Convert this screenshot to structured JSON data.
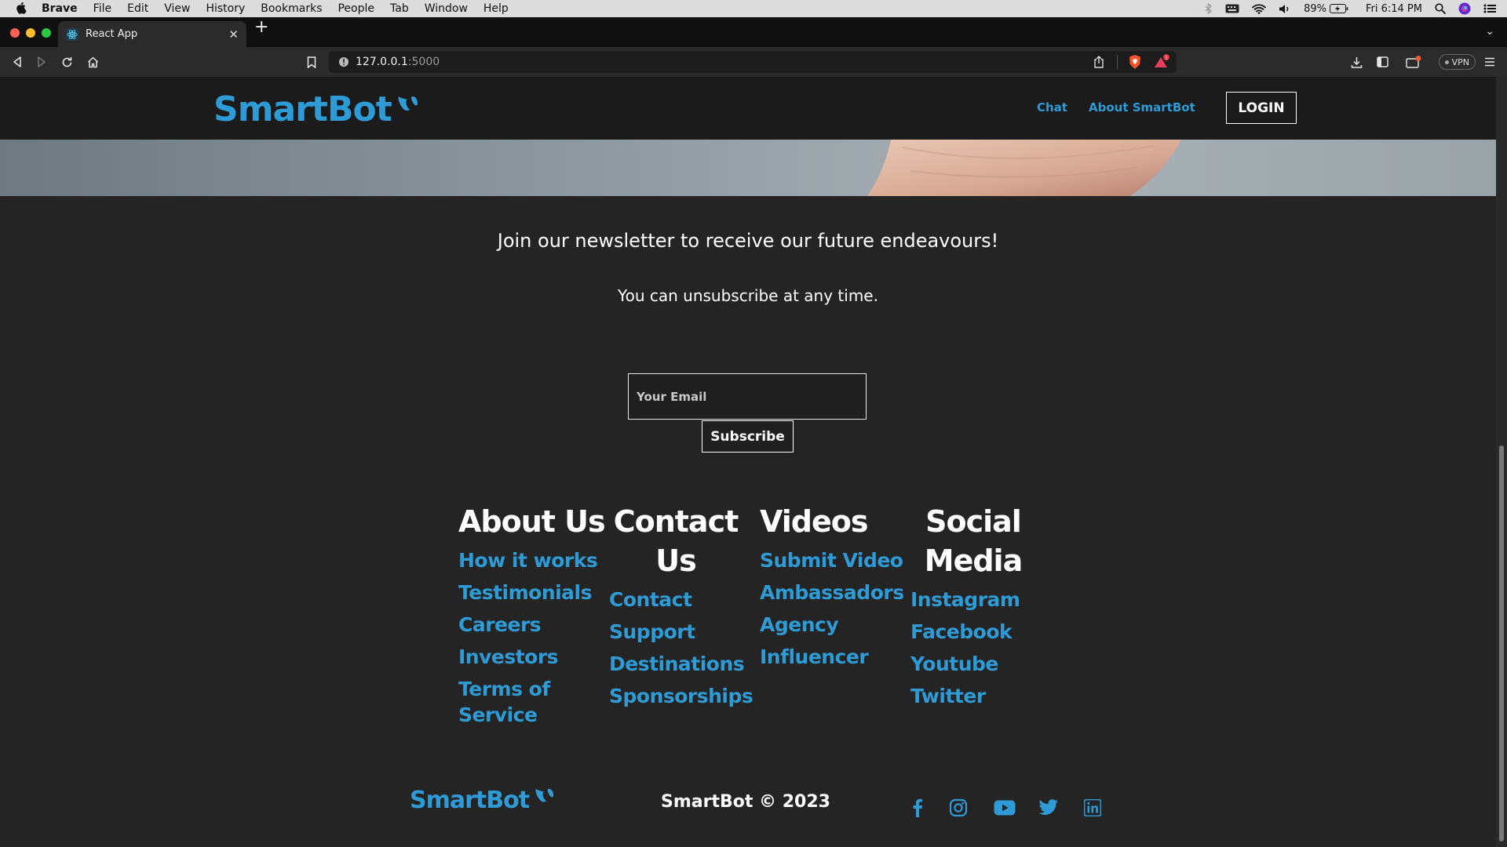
{
  "menubar": {
    "app_name": "Brave",
    "items": [
      "File",
      "Edit",
      "View",
      "History",
      "Bookmarks",
      "People",
      "Tab",
      "Window",
      "Help"
    ],
    "battery": "89%",
    "clock": "Fri 6:14 PM"
  },
  "browser": {
    "tab_title": "React App",
    "url_host": "127.0.0.1",
    "url_port": ":5000",
    "vpn_label": "VPN"
  },
  "nav": {
    "brand": "SmartBot",
    "links": [
      "Chat",
      "About SmartBot"
    ],
    "login_label": "LOGIN"
  },
  "newsletter": {
    "title": "Join our newsletter to receive our future endeavours!",
    "subtitle": "You can unsubscribe at any time.",
    "email_placeholder": "Your Email",
    "subscribe_label": "Subscribe"
  },
  "footer": {
    "columns": [
      {
        "title": "About Us",
        "links": [
          "How it works",
          "Testimonials",
          "Careers",
          "Investors",
          "Terms of Service"
        ]
      },
      {
        "title": "Contact Us",
        "links": [
          "Contact",
          "Support",
          "Destinations",
          "Sponsorships"
        ]
      },
      {
        "title": "Videos",
        "links": [
          "Submit Video",
          "Ambassadors",
          "Agency",
          "Influencer"
        ]
      },
      {
        "title": "Social Media",
        "links": [
          "Instagram",
          "Facebook",
          "Youtube",
          "Twitter"
        ]
      }
    ],
    "brand": "SmartBot",
    "copyright": "SmartBot © 2023",
    "social_icons": [
      "facebook-icon",
      "instagram-icon",
      "youtube-icon",
      "twitter-icon",
      "linkedin-icon"
    ]
  },
  "colors": {
    "accent": "#2e9bd6",
    "background": "#242424",
    "navbar": "#1b1b1b"
  }
}
